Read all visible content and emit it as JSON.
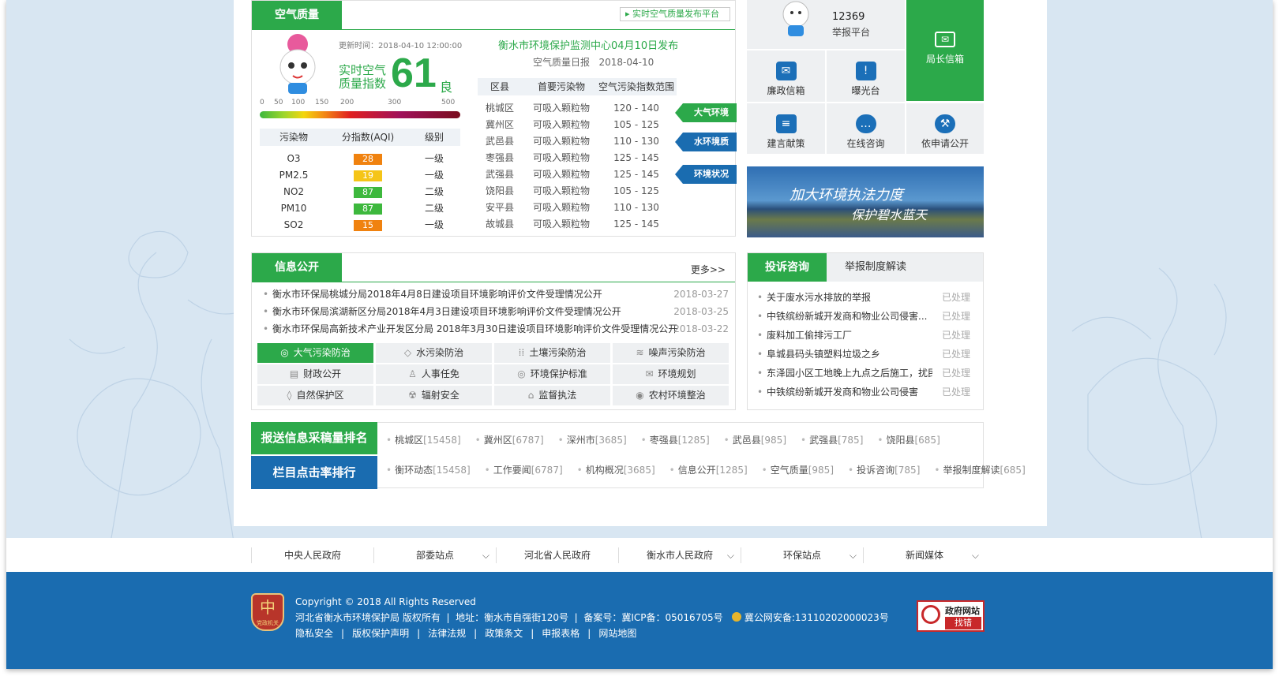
{
  "air": {
    "tab": "空气质量",
    "platform_link": "实时空气质量发布平台",
    "update": "更新时间：2018-04-10 12:00:00",
    "rt_label_1": "实时空气",
    "rt_label_2": "质量指数",
    "aqi": "61",
    "level": "良",
    "scale": [
      "0",
      "50",
      "100",
      "150",
      "200",
      "300",
      "500"
    ],
    "table_headers": [
      "污染物",
      "分指数(AQI)",
      "级别"
    ],
    "pollutants": [
      {
        "name": "O3",
        "aqi": "28",
        "grade": "一级",
        "color": "#f0820f"
      },
      {
        "name": "PM2.5",
        "aqi": "19",
        "grade": "一级",
        "color": "#f5c518"
      },
      {
        "name": "NO2",
        "aqi": "87",
        "grade": "二级",
        "color": "#3db83d"
      },
      {
        "name": "PM10",
        "aqi": "87",
        "grade": "二级",
        "color": "#3db83d"
      },
      {
        "name": "SO2",
        "aqi": "15",
        "grade": "一级",
        "color": "#f0820f"
      }
    ],
    "center_title": "衡水市环境保护监测中心04月10日发布",
    "daily": "空气质量日报",
    "daily_date": "2018-04-10",
    "dist_headers": [
      "区县",
      "首要污染物",
      "空气污染指数范围"
    ],
    "districts": [
      [
        "桃城区",
        "可吸入颗粒物",
        "120 - 140"
      ],
      [
        "冀州区",
        "可吸入颗粒物",
        "105 - 125"
      ],
      [
        "武邑县",
        "可吸入颗粒物",
        "110 - 130"
      ],
      [
        "枣强县",
        "可吸入颗粒物",
        "125 - 145"
      ],
      [
        "武强县",
        "可吸入颗粒物",
        "125 - 145"
      ],
      [
        "饶阳县",
        "可吸入颗粒物",
        "105 - 125"
      ],
      [
        "安平县",
        "可吸入颗粒物",
        "110 - 130"
      ],
      [
        "故城县",
        "可吸入颗粒物",
        "125 - 145"
      ]
    ],
    "side_tabs": [
      "大气环境质量",
      "水环境质量",
      "环境状况公报"
    ]
  },
  "right": {
    "hotline": "12369",
    "hotline_label": "举报平台",
    "director": "局长信箱",
    "cells": [
      "廉政信箱",
      "曝光台",
      "建言献策",
      "在线咨询",
      "依申请公开"
    ],
    "banner_1": "加大环境执法力度",
    "banner_2": "保护碧水蓝天"
  },
  "info": {
    "tab": "信息公开",
    "more": "更多>>",
    "items": [
      [
        "衡水市环保局桃城分局2018年4月8日建设项目环境影响评价文件受理情况公开",
        "2018-03-27"
      ],
      [
        "衡水市环保局滨湖新区分局2018年4月3日建设项目环境影响评价文件受理情况公开",
        "2018-03-25"
      ],
      [
        "衡水市环保局高新技术产业开发区分局 2018年3月30日建设项目环境影响评价文件受理情况公开",
        "2018-03-22"
      ]
    ],
    "grid": [
      "大气污染防治",
      "水污染防治",
      "土壤污染防治",
      "噪声污染防治",
      "财政公开",
      "人事任免",
      "环境保护标准",
      "环境规划",
      "自然保护区",
      "辐射安全",
      "监督执法",
      "农村环境整治"
    ],
    "grid_icons": [
      "◎",
      "◇",
      "⁞⁞",
      "≋",
      "▤",
      "♙",
      "◎",
      "✉",
      "◊",
      "☢",
      "⌂",
      "◉"
    ]
  },
  "complaint": {
    "tab1": "投诉咨询",
    "tab2": "举报制度解读",
    "items": [
      [
        "关于废水污水排放的举报",
        "已处理"
      ],
      [
        "中铁缤纷新城开发商和物业公司侵害...",
        "已处理"
      ],
      [
        "废料加工偷排污工厂",
        "已处理"
      ],
      [
        "阜城县码头镇塑料垃圾之乡",
        "已处理"
      ],
      [
        "东泽园小区工地晚上九点之后施工，扰民",
        "已处理"
      ],
      [
        "中铁缤纷新城开发商和物业公司侵害",
        "已处理"
      ]
    ]
  },
  "rank": {
    "title1": "报送信息采稿量排名",
    "title2": "栏目点击率排行",
    "row1": [
      [
        "桃城区",
        "[15458]"
      ],
      [
        "冀州区",
        "[6787]"
      ],
      [
        "深州市",
        "[3685]"
      ],
      [
        "枣强县",
        "[1285]"
      ],
      [
        "武邑县",
        "[985]"
      ],
      [
        "武强县",
        "[785]"
      ],
      [
        "饶阳县",
        "[685]"
      ]
    ],
    "row2": [
      [
        "衡环动态",
        "[15458]"
      ],
      [
        "工作要闻",
        "[6787]"
      ],
      [
        "机构概况",
        "[3685]"
      ],
      [
        "信息公开",
        "[1285]"
      ],
      [
        "空气质量",
        "[985]"
      ],
      [
        "投诉咨询",
        "[785]"
      ],
      [
        "举报制度解读",
        "[685]"
      ]
    ]
  },
  "links": [
    "中央人民政府",
    "部委站点",
    "河北省人民政府",
    "衡水市人民政府",
    "环保站点",
    "新闻媒体"
  ],
  "footer": {
    "copyright": "Copyright © 2018 All Rights Reserved",
    "org": "河北省衡水市环境保护局 版权所有",
    "addr": "地址：衡水市自强街120号",
    "icp": "备案号：冀ICP备：05016705号",
    "police": "冀公网安备:13110202000023号",
    "bottom_links": [
      "隐私安全",
      "版权保护声明",
      "法律法规",
      "政策条文",
      "申报表格",
      "网站地图"
    ],
    "badge_1": "政府网站",
    "badge_2": "找错",
    "emblem": "党政机关"
  },
  "colors": {
    "green": "#2ca94a",
    "blue": "#1a6cb0",
    "bg": "#d8e6f2"
  }
}
